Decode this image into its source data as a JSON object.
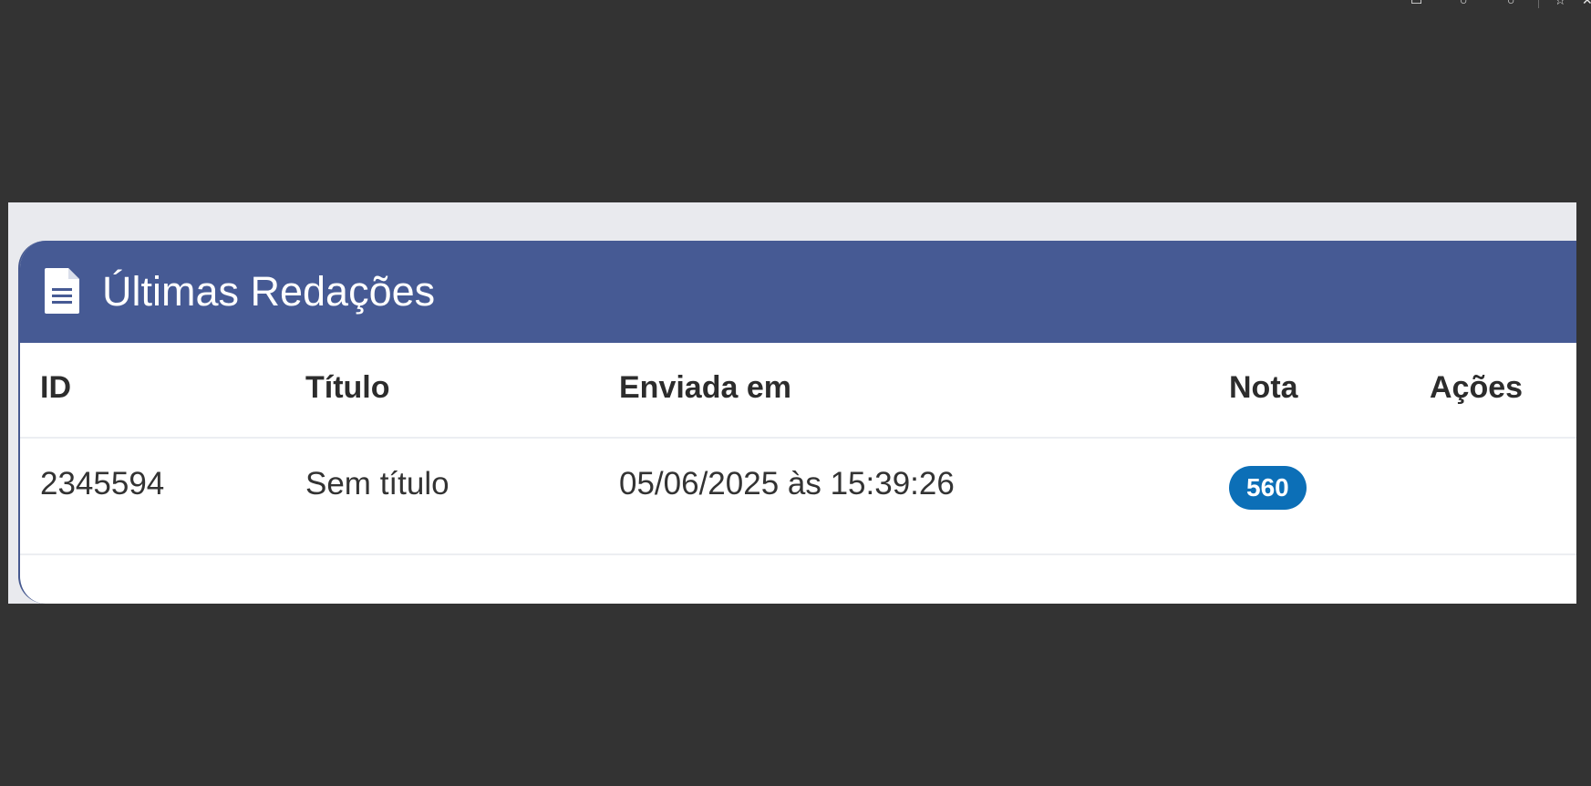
{
  "card": {
    "title": "Últimas Redações"
  },
  "table": {
    "columns": [
      "ID",
      "Título",
      "Enviada em",
      "Nota",
      "Ações"
    ],
    "rows": [
      {
        "id": "2345594",
        "titulo": "Sem título",
        "enviada_em": "05/06/2025 às 15:39:26",
        "nota": "560",
        "acoes": ""
      }
    ]
  },
  "colors": {
    "background": "#333333",
    "header": "#465a94",
    "badge": "#0c6fb7"
  },
  "icons": {
    "header": "document-icon"
  }
}
